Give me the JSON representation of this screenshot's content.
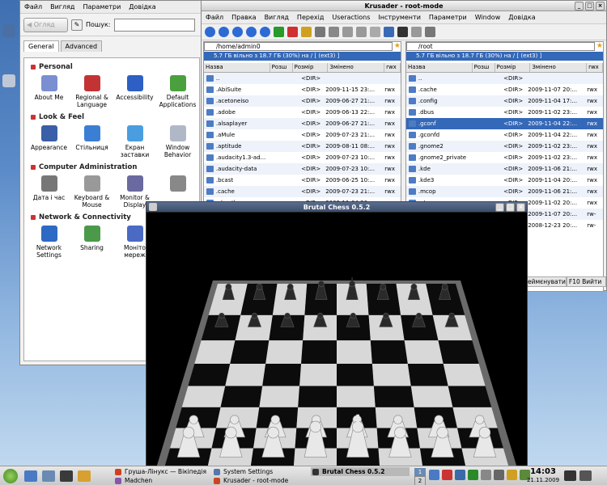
{
  "system_settings": {
    "menu": [
      "Файл",
      "Вигляд",
      "Параметри",
      "Довідка"
    ],
    "back_label": "Огляд",
    "search_label": "Пошук:",
    "search_value": "",
    "tabs": [
      "General",
      "Advanced"
    ],
    "categories": [
      {
        "title": "Personal",
        "items": [
          {
            "label": "About Me",
            "icon": "about-me-icon",
            "color": "#7a8fd1"
          },
          {
            "label": "Regional & Language",
            "icon": "flag-icon",
            "color": "#c33333"
          },
          {
            "label": "Accessibility",
            "icon": "accessibility-icon",
            "color": "#2d5fc4"
          },
          {
            "label": "Default Applications",
            "icon": "default-apps-icon",
            "color": "#4aa03c"
          }
        ]
      },
      {
        "title": "Look & Feel",
        "items": [
          {
            "label": "Appearance",
            "icon": "appearance-icon",
            "color": "#3a5fa8"
          },
          {
            "label": "Стільниця",
            "icon": "desktop-icon",
            "color": "#3b7fd4"
          },
          {
            "label": "Екран заставки",
            "icon": "screensaver-icon",
            "color": "#4a9ee0"
          },
          {
            "label": "Window Behavior",
            "icon": "window-icon",
            "color": "#b0b8c8"
          }
        ]
      },
      {
        "title": "Computer Administration",
        "items": [
          {
            "label": "Дата і час",
            "icon": "calendar-icon",
            "color": "#777777"
          },
          {
            "label": "Keyboard & Mouse",
            "icon": "keyboard-icon",
            "color": "#999999"
          },
          {
            "label": "Monitor & Display",
            "icon": "monitor-icon",
            "color": "#6a6aa0"
          },
          {
            "label": "",
            "icon": "disk-icon",
            "color": "#888888"
          }
        ]
      },
      {
        "title": "Network & Connectivity",
        "items": [
          {
            "label": "Network Settings",
            "icon": "network-icon",
            "color": "#2d6ac4"
          },
          {
            "label": "Sharing",
            "icon": "sharing-icon",
            "color": "#4a9a4a"
          },
          {
            "label": "Моніто мереж",
            "icon": "network-monitor-icon",
            "color": "#4a6ac4"
          }
        ]
      }
    ]
  },
  "krusader": {
    "title": "Krusader - root-mode",
    "menu": [
      "Файл",
      "Правка",
      "Вигляд",
      "Перехід",
      "Useractions",
      "Інструменти",
      "Параметри",
      "Window",
      "Довідка"
    ],
    "left": {
      "path": "/home/admin0",
      "free": "5.7 ГБ вільно з 18.7 ГБ (30%) на / [ (ext3) ]",
      "headers": [
        "Назва",
        "Розш",
        "Розмір",
        "Змінено",
        "rwx"
      ],
      "rows": [
        {
          "name": "..",
          "size": "<DIR>",
          "date": "",
          "rwx": ""
        },
        {
          "name": ".AbiSuite",
          "size": "<DIR>",
          "date": "2009-11-15 23:...",
          "rwx": "rwx"
        },
        {
          "name": ".acetoneiso",
          "size": "<DIR>",
          "date": "2009-06-27 21:...",
          "rwx": "rwx"
        },
        {
          "name": ".adobe",
          "size": "<DIR>",
          "date": "2009-06-13 22:...",
          "rwx": "rwx"
        },
        {
          "name": ".alsaplayer",
          "size": "<DIR>",
          "date": "2009-06-27 21:...",
          "rwx": "rwx"
        },
        {
          "name": ".aMule",
          "size": "<DIR>",
          "date": "2009-07-23 21:...",
          "rwx": "rwx"
        },
        {
          "name": ".aptitude",
          "size": "<DIR>",
          "date": "2009-08-11 08:...",
          "rwx": "rwx"
        },
        {
          "name": ".audacity1.3-ad...",
          "size": "<DIR>",
          "date": "2009-07-23 10:...",
          "rwx": "rwx"
        },
        {
          "name": ".audacity-data",
          "size": "<DIR>",
          "date": "2009-07-23 10:...",
          "rwx": "rwx"
        },
        {
          "name": ".bcast",
          "size": "<DIR>",
          "date": "2009-06-25 10:...",
          "rwx": "rwx"
        },
        {
          "name": ".cache",
          "size": "<DIR>",
          "date": "2009-07-23 21:...",
          "rwx": "rwx"
        },
        {
          "name": ".clamtk",
          "size": "<DIR>",
          "date": "2009-11-04 20:...",
          "rwx": "rwx"
        }
      ]
    },
    "right": {
      "path": "/root",
      "free": "5.7 ГБ вільно з 18.7 ГБ (30%) на / [ (ext3) ]",
      "headers": [
        "Назва",
        "Розш",
        "Розмір",
        "Змінено",
        "rwx"
      ],
      "rows": [
        {
          "name": "..",
          "size": "<DIR>",
          "date": "",
          "rwx": ""
        },
        {
          "name": ".cache",
          "size": "<DIR>",
          "date": "2009-11-07 20:...",
          "rwx": "rwx"
        },
        {
          "name": ".config",
          "size": "<DIR>",
          "date": "2009-11-04 17:...",
          "rwx": "rwx"
        },
        {
          "name": ".dbus",
          "size": "<DIR>",
          "date": "2009-11-02 23:...",
          "rwx": "rwx"
        },
        {
          "name": ".gconf",
          "size": "<DIR>",
          "date": "2009-11-04 22:...",
          "rwx": "rwx"
        },
        {
          "name": ".gconfd",
          "size": "<DIR>",
          "date": "2009-11-04 22:...",
          "rwx": "rwx"
        },
        {
          "name": ".gnome2",
          "size": "<DIR>",
          "date": "2009-11-02 23:...",
          "rwx": "rwx"
        },
        {
          "name": ".gnome2_private",
          "size": "<DIR>",
          "date": "2009-11-02 23:...",
          "rwx": "rwx"
        },
        {
          "name": ".kde",
          "size": "<DIR>",
          "date": "2009-11-06 21:...",
          "rwx": "rwx"
        },
        {
          "name": ".kde3",
          "size": "<DIR>",
          "date": "2009-11-04 20:...",
          "rwx": "rwx"
        },
        {
          "name": ".mcop",
          "size": "<DIR>",
          "date": "2009-11-06 21:...",
          "rwx": "rwx"
        },
        {
          "name": ".qt",
          "size": "<DIR>",
          "date": "2009-11-02 20:...",
          "rwx": "rwx"
        },
        {
          "name": "",
          "size": "",
          "date": "2009-11-07 20:...",
          "rwx": "rw-"
        },
        {
          "name": "",
          "size": "",
          "date": "2008-12-23 20:...",
          "rwx": "rw-"
        }
      ]
    },
    "selected_right_row": 4,
    "f9_label": "еймєнувати",
    "f10_label": "F10 Вийти"
  },
  "chess": {
    "title": "Brutal Chess 0.5.2"
  },
  "taskbar": {
    "tasks": [
      {
        "label": "Груша-Лінукс — Вікіпедія",
        "color": "#d04020"
      },
      {
        "label": "System Settings",
        "color": "#5577aa"
      },
      {
        "label": "Brutal Chess 0.5.2",
        "color": "#333333"
      },
      {
        "label": "Madchen",
        "color": "#8855aa"
      },
      {
        "label": "Krusader - root-mode",
        "color": "#cc4422"
      }
    ],
    "pager": [
      "1",
      "2"
    ],
    "time": "14:03",
    "date": "21.11.2009"
  }
}
